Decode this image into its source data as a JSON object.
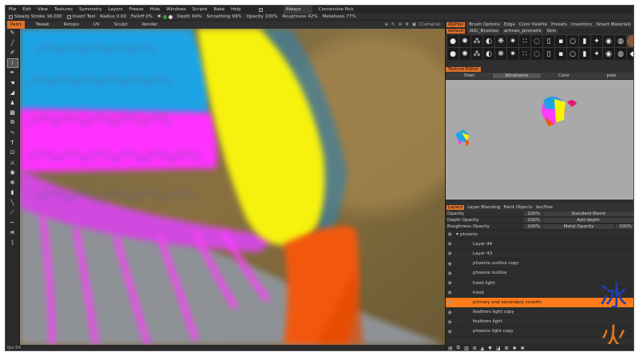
{
  "menu": [
    "File",
    "Edit",
    "View",
    "Textures",
    "Symmetry",
    "Layers",
    "Freeze",
    "Hide",
    "Windows",
    "Scripts",
    "Bake",
    "Help"
  ],
  "menu_extra": {
    "always": "Always",
    "pick": "Connective Pick"
  },
  "options": {
    "steady": "Steady Stroke",
    "steady_val": "16.000",
    "invert": "Invert Tool",
    "radius": "Radius",
    "radius_val": "0.00",
    "falloff": "Falloff",
    "falloff_val": "0%",
    "depth": "Depth",
    "depth_val": "64%",
    "smoothing": "Smoothing",
    "smoothing_val": "99%",
    "opacity": "Opacity",
    "opacity_val": "100%",
    "roughness": "Roughness",
    "roughness_val": "42%",
    "metalness": "Metalness",
    "metalness_val": "77%"
  },
  "tabs": [
    "Paint",
    "Tweak",
    "Retopo",
    "UV",
    "Sculpt",
    "Render"
  ],
  "viewport_label": "[Camera]",
  "status": "fps:54",
  "panel_tabs": [
    "AlpHas",
    "Brush Options",
    "Edge",
    "Color Palette",
    "Presets",
    "Inventory",
    "Smart Materials"
  ],
  "brush_tabs": [
    "default",
    "3DC_Brushes",
    "artman_pinmatik",
    "Skin"
  ],
  "texture_editor": {
    "title": "Texture Editor",
    "modes": [
      "Pixel",
      "Wireframe",
      "Color",
      "pale"
    ]
  },
  "layer_tabs": [
    "Layers",
    "Layer Blending",
    "Paint Objects",
    "VoxTree"
  ],
  "layer_props": [
    {
      "name": "Opacity",
      "val": "100%",
      "sel": "Standard Blend"
    },
    {
      "name": "Depth Opacity",
      "val": "100%",
      "sel": "Add depth"
    },
    {
      "name": "Roughness Opacity",
      "val": "100%",
      "sel": "Metal Opacity",
      "sel_val": "100%"
    }
  ],
  "layers": [
    {
      "label": "phoenix",
      "folder": true
    },
    {
      "label": "Layer 44"
    },
    {
      "label": "Layer 43"
    },
    {
      "label": "phoenix outline copy"
    },
    {
      "label": "phoenix outline"
    },
    {
      "label": "hood light"
    },
    {
      "label": "hood"
    },
    {
      "label": "primary and secondary coverts",
      "selected": true
    },
    {
      "label": "feathers light copy"
    },
    {
      "label": "feathers light"
    },
    {
      "label": "phoenix light copy"
    }
  ],
  "watermark": {
    "top": "冰",
    "bottom": "火"
  },
  "colors": {
    "accent": "#e1702b",
    "selected": "#ff7b1a"
  }
}
